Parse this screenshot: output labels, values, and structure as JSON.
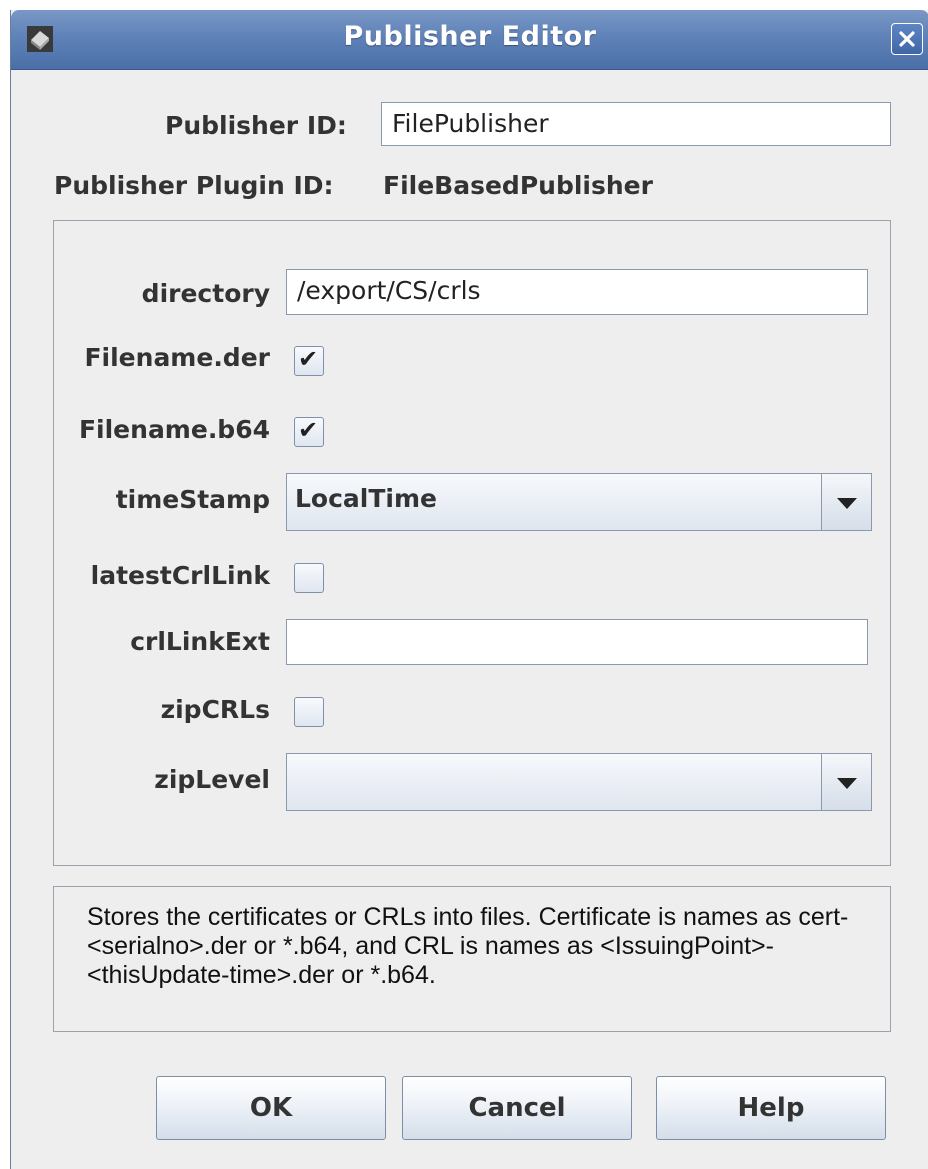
{
  "window": {
    "title": "Publisher Editor"
  },
  "header": {
    "publisher_id_label": "Publisher ID:",
    "publisher_id_value": "FilePublisher",
    "plugin_id_label": "Publisher Plugin ID:",
    "plugin_id_value": "FileBasedPublisher"
  },
  "params": {
    "directory_label": "directory",
    "directory_value": "/export/CS/crls",
    "filename_der_label": "Filename.der",
    "filename_der_checked": true,
    "filename_b64_label": "Filename.b64",
    "filename_b64_checked": true,
    "timestamp_label": "timeStamp",
    "timestamp_value": "LocalTime",
    "latest_crl_link_label": "latestCrlLink",
    "latest_crl_link_checked": false,
    "crl_link_ext_label": "crlLinkExt",
    "crl_link_ext_value": "",
    "zip_crls_label": "zipCRLs",
    "zip_crls_checked": false,
    "zip_level_label": "zipLevel",
    "zip_level_value": "",
    "check_glyph": "✔"
  },
  "description": {
    "text": "Stores the certificates or CRLs into files. Certificate is names as cert-<serialno>.der or *.b64, and CRL is names as <IssuingPoint>-<thisUpdate-time>.der or *.b64."
  },
  "buttons": {
    "ok": "OK",
    "cancel": "Cancel",
    "help": "Help"
  },
  "colors": {
    "titlebar": "#5f82b8",
    "background": "#eeeeee"
  },
  "icons": {
    "app": "app-icon",
    "close": "close-icon",
    "dropdown": "chevron-down-icon"
  }
}
